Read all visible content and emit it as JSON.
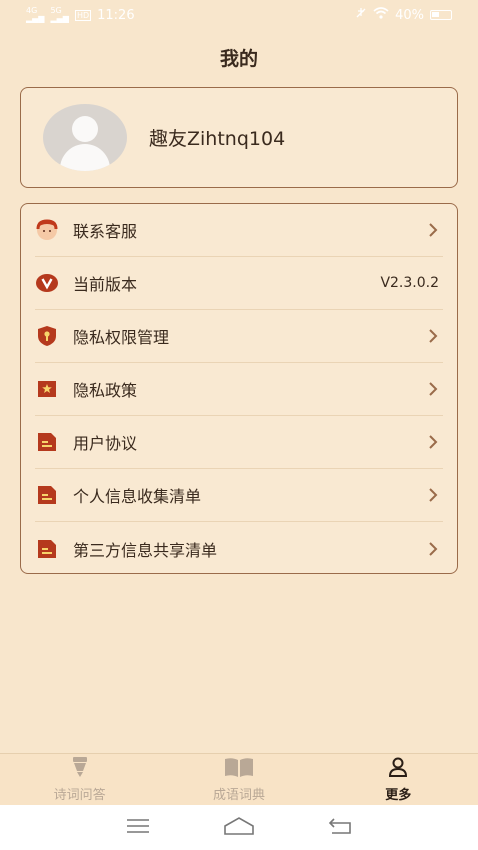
{
  "status_bar": {
    "network_left": "4G",
    "network_right": "5G",
    "hd_badge": "HD",
    "time": "11:26",
    "battery": "40%"
  },
  "page": {
    "title": "我的"
  },
  "profile": {
    "username": "趣友Zihtnq104"
  },
  "menu": {
    "items": [
      {
        "label": "联系客服",
        "icon": "customer-service-icon",
        "value": ""
      },
      {
        "label": "当前版本",
        "icon": "version-icon",
        "value": "V2.3.0.2"
      },
      {
        "label": "隐私权限管理",
        "icon": "privacy-shield-icon",
        "value": ""
      },
      {
        "label": "隐私政策",
        "icon": "policy-star-icon",
        "value": ""
      },
      {
        "label": "用户协议",
        "icon": "document-icon",
        "value": ""
      },
      {
        "label": "个人信息收集清单",
        "icon": "document-icon",
        "value": ""
      },
      {
        "label": "第三方信息共享清单",
        "icon": "document-icon",
        "value": ""
      }
    ]
  },
  "tabs": [
    {
      "label": "诗词问答",
      "icon": "brush-icon",
      "active": false
    },
    {
      "label": "成语词典",
      "icon": "book-icon",
      "active": false
    },
    {
      "label": "更多",
      "icon": "user-icon",
      "active": true
    }
  ],
  "colors": {
    "background": "#f8e6cc",
    "card_border": "#9a6b4a",
    "accent": "#b5391d",
    "tab_inactive": "#b9a896",
    "tab_active": "#2a1e16"
  }
}
